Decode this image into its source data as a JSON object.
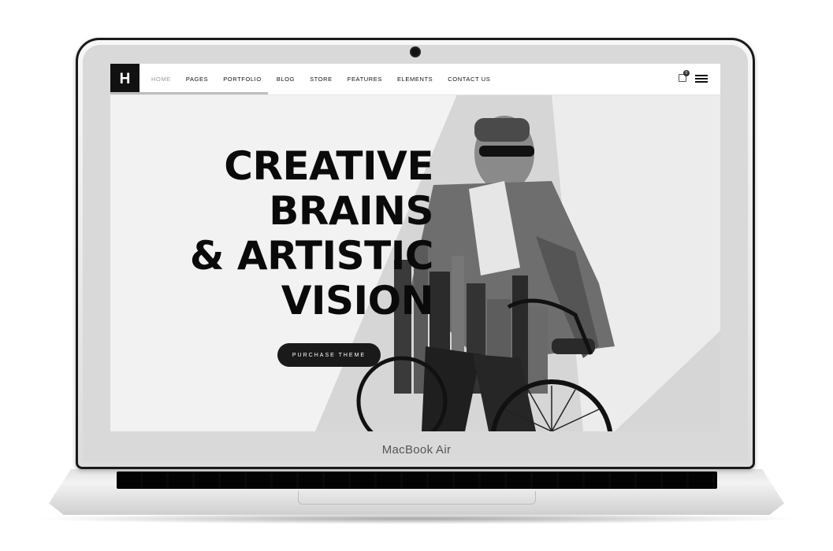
{
  "device": {
    "brand_label": "MacBook Air"
  },
  "site": {
    "logo": "H",
    "nav": {
      "items": [
        {
          "label": "HOME",
          "active": true
        },
        {
          "label": "PAGES"
        },
        {
          "label": "PORTFOLIO"
        },
        {
          "label": "BLOG"
        },
        {
          "label": "STORE"
        },
        {
          "label": "FEATURES"
        },
        {
          "label": "ELEMENTS"
        },
        {
          "label": "CONTACT US"
        }
      ],
      "cart_count": "0"
    },
    "hero": {
      "headline": [
        "CREATIVE",
        "BRAINS",
        "& ARTISTIC",
        "VISION"
      ],
      "cta_label": "PURCHASE THEME"
    }
  },
  "icons": [
    "logo-mark",
    "cart-icon",
    "hamburger-menu-icon",
    "camera-icon"
  ],
  "colors": {
    "accent": "#111111",
    "hero_bg": "#f2f2f2",
    "nav_active": "#9a9a9a"
  }
}
